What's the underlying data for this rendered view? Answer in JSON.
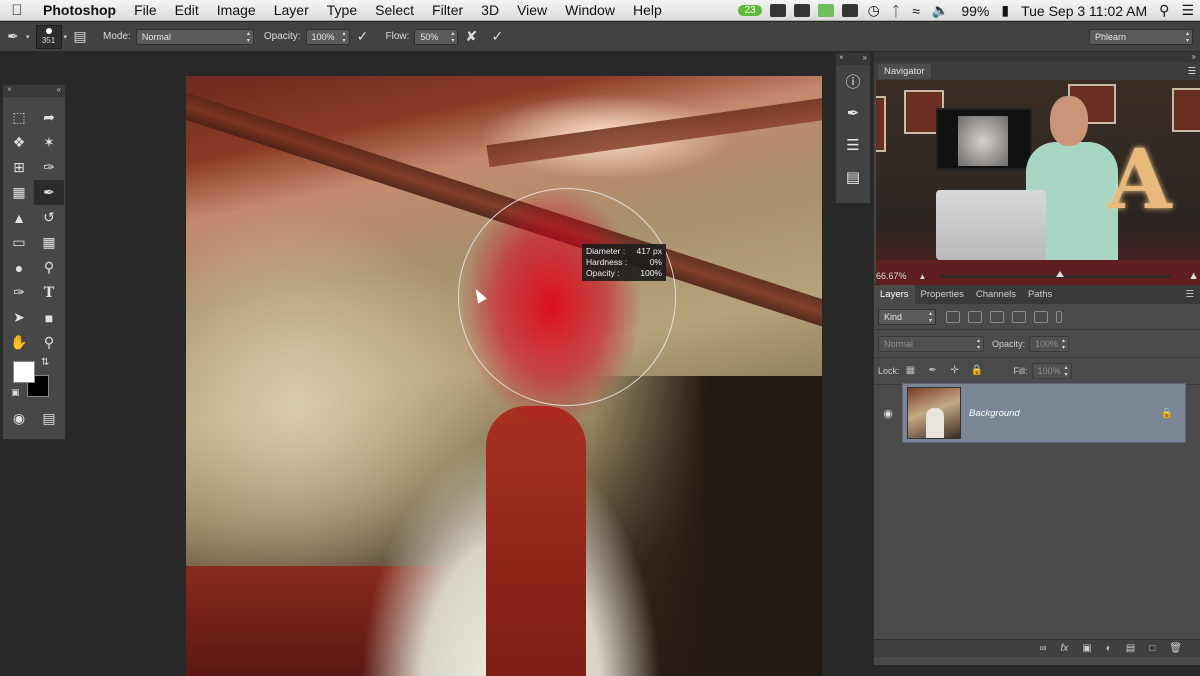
{
  "menubar": {
    "app": "Photoshop",
    "items": [
      "File",
      "Edit",
      "Image",
      "Layer",
      "Type",
      "Select",
      "Filter",
      "3D",
      "View",
      "Window",
      "Help"
    ],
    "tray_badge": "23",
    "battery": "99%",
    "clock": "Tue Sep 3  11:02 AM"
  },
  "options": {
    "brush_size": "351",
    "mode_label": "Mode:",
    "mode_value": "Normal",
    "opacity_label": "Opacity:",
    "opacity_value": "100%",
    "flow_label": "Flow:",
    "flow_value": "50%",
    "workspace": "Phlearn"
  },
  "tooltip": {
    "diameter_label": "Diameter :",
    "diameter_value": "417 px",
    "hardness_label": "Hardness :",
    "hardness_value": "0%",
    "opacity_label": "Opacity :",
    "opacity_value": "100%"
  },
  "navigator": {
    "title": "Navigator",
    "zoom": "66.67%",
    "zoom_fraction": 0.52,
    "watermark_letter": "A"
  },
  "layers": {
    "tabs": [
      "Layers",
      "Properties",
      "Channels",
      "Paths"
    ],
    "kind_label": "Kind",
    "blend_mode": "Normal",
    "opacity_label": "Opacity:",
    "opacity_value": "100%",
    "lock_label": "Lock:",
    "fill_label": "Fill:",
    "fill_value": "100%",
    "layer_name": "Background"
  },
  "colors": {
    "foreground": "#ffffff",
    "background": "#000000",
    "selected_layer": "#7b8797"
  }
}
